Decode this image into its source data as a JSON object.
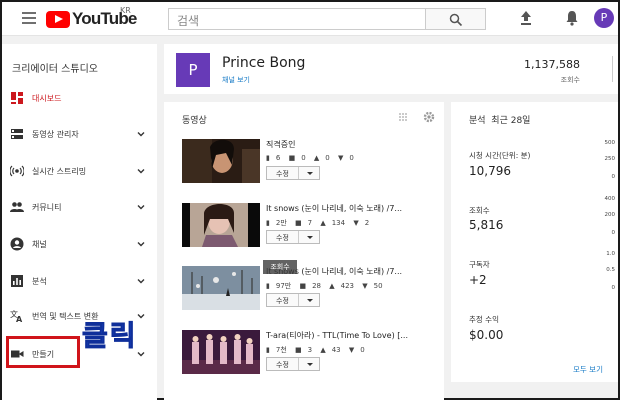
{
  "header": {
    "logo_text": "YouTube",
    "logo_region": "KR",
    "search_placeholder": "검색",
    "avatar_letter": "P"
  },
  "sidebar": {
    "title": "크리에이터 스튜디오",
    "items": [
      {
        "label": "대시보드",
        "icon": "dashboard-icon",
        "active": true
      },
      {
        "label": "동영상 관리자",
        "icon": "video-manager-icon"
      },
      {
        "label": "실시간 스트리밍",
        "icon": "live-stream-icon"
      },
      {
        "label": "커뮤니티",
        "icon": "community-icon"
      },
      {
        "label": "채널",
        "icon": "channel-icon"
      },
      {
        "label": "분석",
        "icon": "analytics-icon"
      },
      {
        "label": "번역 및 텍스트 변환",
        "icon": "translate-icon"
      },
      {
        "label": "만들기",
        "icon": "create-icon"
      }
    ],
    "annotation": "클릭"
  },
  "channel": {
    "avatar_letter": "P",
    "name": "Prince Bong",
    "link": "채널 보기",
    "views_value": "1,137,588",
    "views_label": "조회수"
  },
  "videos": {
    "title": "동영상",
    "edit_label": "수정",
    "tooltip": "조회수",
    "items": [
      {
        "title": "직격증인",
        "views": "6",
        "comments": "0",
        "likes": "0",
        "dislikes": "0"
      },
      {
        "title": "It snows (눈이 나리네, 이숙 노래) /7...",
        "views": "2만",
        "comments": "7",
        "likes": "134",
        "dislikes": "2"
      },
      {
        "title": "It snows (눈이 나리네, 이숙 노래) /7...",
        "views": "97만",
        "comments": "28",
        "likes": "423",
        "dislikes": "50"
      },
      {
        "title": "T-ara(티아라) - TTL(Time To Love) [...",
        "views": "7천",
        "comments": "3",
        "likes": "43",
        "dislikes": "0"
      }
    ]
  },
  "analytics": {
    "title": "분석",
    "period": "최근 28일",
    "metrics": [
      {
        "label": "시청 시간(단위: 분)",
        "value": "10,796",
        "axis": [
          "500",
          "250",
          "0"
        ]
      },
      {
        "label": "조회수",
        "value": "5,816",
        "axis": [
          "400",
          "200",
          "0"
        ]
      },
      {
        "label": "구독자",
        "value": "+2",
        "axis": [
          "1.0",
          "0.5",
          "0"
        ]
      },
      {
        "label": "추정 수익",
        "value": "$0.00",
        "axis": []
      }
    ],
    "see_all": "모두 보기"
  }
}
